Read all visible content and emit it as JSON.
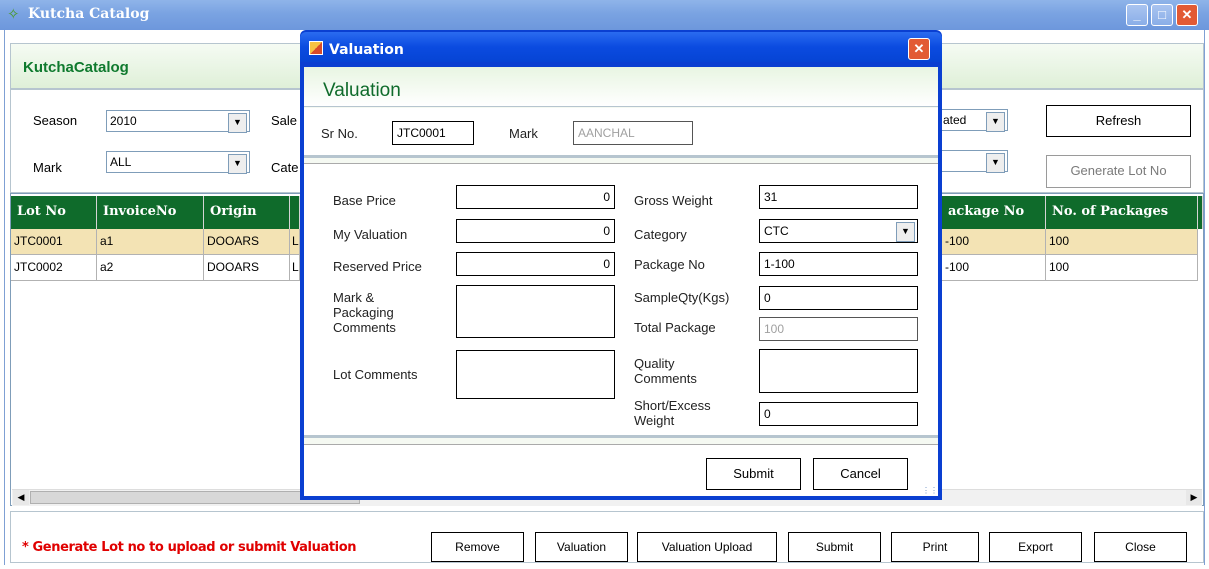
{
  "window": {
    "title": "Kutcha Catalog",
    "header": "KutchaCatalog"
  },
  "filters": {
    "season_label": "Season",
    "season_value": "2010",
    "sale_label": "Sale",
    "mark_label": "Mark",
    "mark_value": "ALL",
    "category_label": "Cate",
    "status_value": "ated",
    "refresh_label": "Refresh",
    "generate_lot_label": "Generate Lot No"
  },
  "grid": {
    "columns": [
      "Lot No",
      "InvoiceNo",
      "Origin",
      "ackage No",
      "No. of Packages"
    ],
    "rows": [
      {
        "lot": "JTC0001",
        "invoice": "a1",
        "origin": "DOOARS",
        "col4": "L",
        "package": "-100",
        "packages": "100"
      },
      {
        "lot": "JTC0002",
        "invoice": "a2",
        "origin": "DOOARS",
        "col4": "L",
        "package": "-100",
        "packages": "100"
      }
    ]
  },
  "bottom": {
    "warning": "* Generate Lot no to upload or submit Valuation",
    "buttons": [
      "Remove",
      "Valuation",
      "Valuation Upload",
      "Submit",
      "Print",
      "Export",
      "Close"
    ]
  },
  "dialog": {
    "title": "Valuation",
    "heading": "Valuation",
    "sr_label": "Sr No.",
    "sr_value": "JTC0001",
    "mark_label": "Mark",
    "mark_value": "AANCHAL",
    "base_price_label": "Base Price",
    "base_price_value": "0",
    "my_valuation_label": "My Valuation",
    "my_valuation_value": "0",
    "reserved_price_label": "Reserved Price",
    "reserved_price_value": "0",
    "mark_pack_label_1": "Mark &",
    "mark_pack_label_2": "Packaging",
    "mark_pack_label_3": "Comments",
    "lot_comments_label": "Lot Comments",
    "gross_weight_label": "Gross Weight",
    "gross_weight_value": "31",
    "category_label": "Category",
    "category_value": "CTC",
    "package_no_label": "Package No",
    "package_no_value": "1-100",
    "sample_qty_label": "SampleQty(Kgs)",
    "sample_qty_value": "0",
    "total_package_label": "Total Package",
    "total_package_value": "100",
    "quality_comments_label_1": "Quality",
    "quality_comments_label_2": "Comments",
    "short_excess_label_1": "Short/Excess",
    "short_excess_label_2": "Weight",
    "short_excess_value": "0",
    "submit_label": "Submit",
    "cancel_label": "Cancel"
  }
}
